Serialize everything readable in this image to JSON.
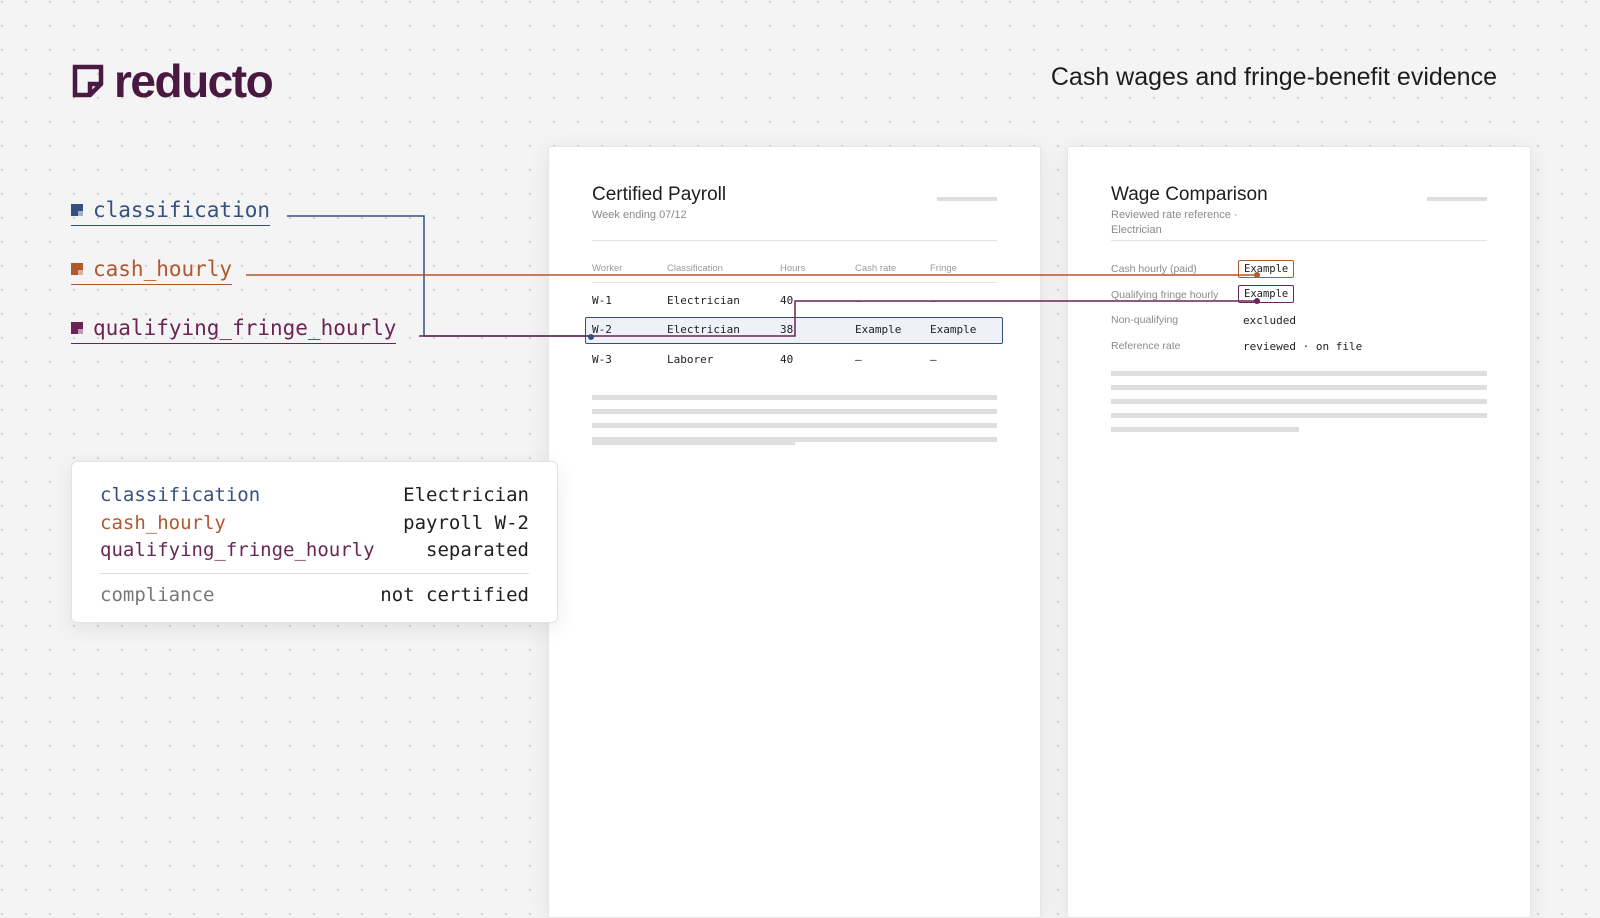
{
  "brand": {
    "name": "reducto"
  },
  "header": {
    "title": "Cash wages and fringe-benefit evidence"
  },
  "fields": {
    "classification": "classification",
    "cash_hourly": "cash_hourly",
    "qualifying_fringe_hourly": "qualifying_fringe_hourly"
  },
  "summary": {
    "rows": [
      {
        "key": "classification",
        "value": "Electrician"
      },
      {
        "key": "cash_hourly",
        "value": "payroll W-2"
      },
      {
        "key": "qualifying_fringe_hourly",
        "value": "separated"
      }
    ],
    "compliance": {
      "key": "compliance",
      "value": "not certified"
    }
  },
  "payroll": {
    "title": "Certified Payroll",
    "subtitle": "Week ending 07/12",
    "columns": [
      "Worker",
      "Classification",
      "Hours",
      "Cash rate",
      "Fringe"
    ],
    "rows": [
      [
        "W-1",
        "Electrician",
        "40",
        "—",
        "—"
      ],
      [
        "W-2",
        "Electrician",
        "38",
        "Example",
        "Example"
      ],
      [
        "W-3",
        "Laborer",
        "40",
        "—",
        "—"
      ]
    ]
  },
  "comparison": {
    "title": "Wage Comparison",
    "subtitle_line1": "Reviewed rate reference ·",
    "subtitle_line2": "Electrician",
    "rows": [
      {
        "label": "Cash hourly (paid)",
        "value": "Example"
      },
      {
        "label": "Qualifying fringe hourly",
        "value": "Example"
      },
      {
        "label": "Non-qualifying",
        "value": "excluded"
      },
      {
        "label": "Reference rate",
        "value": "reviewed · on file"
      }
    ]
  },
  "colors": {
    "brand": "#4a1942",
    "classification": "#35507f",
    "cash_hourly": "#b0582e",
    "qualifying_fringe_hourly": "#6b2455"
  }
}
